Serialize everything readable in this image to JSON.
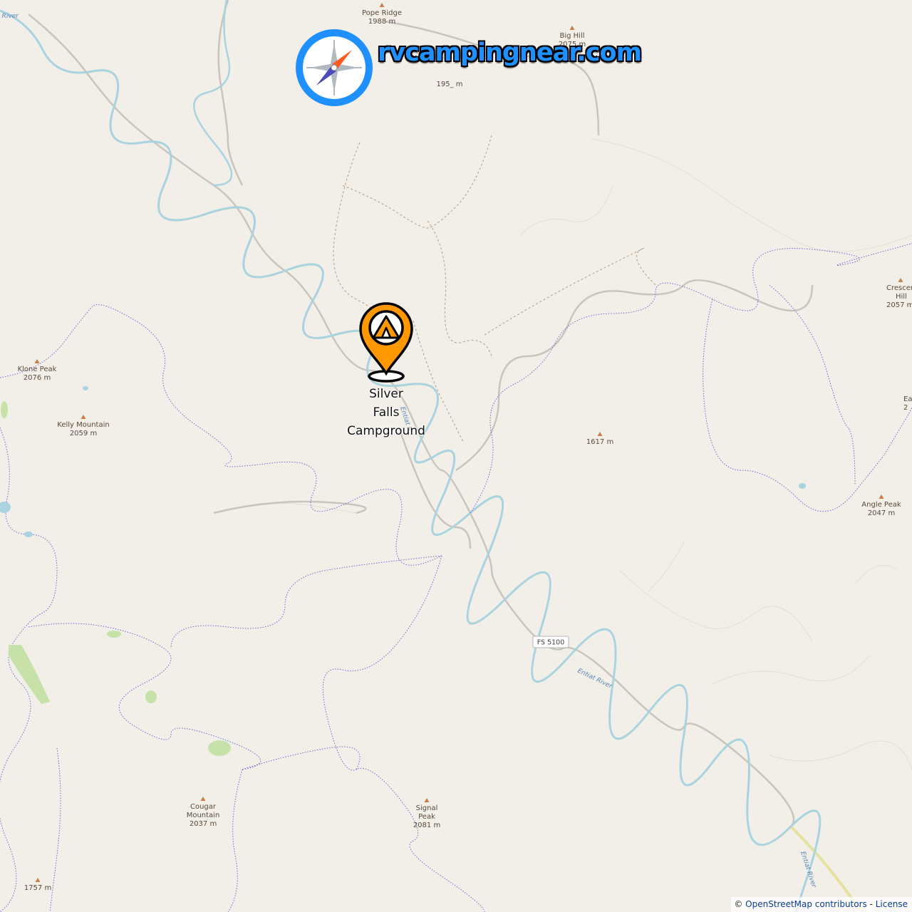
{
  "logo": {
    "text": "rvcampingnear.com",
    "icon": "compass-icon"
  },
  "campground": {
    "name_lines": [
      "Silver",
      "Falls",
      "Campground"
    ],
    "icon": "tent-pin-icon",
    "marker_color": "#ff9800"
  },
  "peaks": [
    {
      "id": "pope-ridge",
      "name": "Pope Ridge",
      "elevation": "1988 m"
    },
    {
      "id": "big-hill",
      "name": "Big Hill",
      "elevation": "2075 m"
    },
    {
      "id": "hidden",
      "name": "",
      "elevation": "195_ m"
    },
    {
      "id": "klone-peak",
      "name": "Klone Peak",
      "elevation": "2076 m"
    },
    {
      "id": "kelly-mountain",
      "name": "Kelly Mountain",
      "elevation": "2059 m"
    },
    {
      "id": "unnamed-1617",
      "name": "",
      "elevation": "1617 m"
    },
    {
      "id": "crescent-hill",
      "name": "Crescen Hill",
      "elevation": "2057 m"
    },
    {
      "id": "east",
      "name": "Eas",
      "elevation": "2"
    },
    {
      "id": "angle-peak",
      "name": "Angle Peak",
      "elevation": "2047 m"
    },
    {
      "id": "cougar-mountain",
      "name": "Cougar Mountain",
      "elevation": "2037 m"
    },
    {
      "id": "signal-peak",
      "name": "Signal Peak",
      "elevation": "2081 m"
    },
    {
      "id": "unnamed-1757",
      "name": "",
      "elevation": "1757 m"
    }
  ],
  "road_shield": "FS 5100",
  "river_labels": [
    "Entiat River",
    "Entiat R",
    "Entiat River",
    "r River"
  ],
  "attribution": {
    "prefix": "©",
    "osm": "OpenStreetMap contributors",
    "separator": " - ",
    "license": "License"
  },
  "colors": {
    "background": "#f2efe9",
    "river": "#a8d3df",
    "boundary": "#6a6acd",
    "road": "#bdbdbd",
    "peak": "#c8804a",
    "accent": "#1e90ff"
  }
}
